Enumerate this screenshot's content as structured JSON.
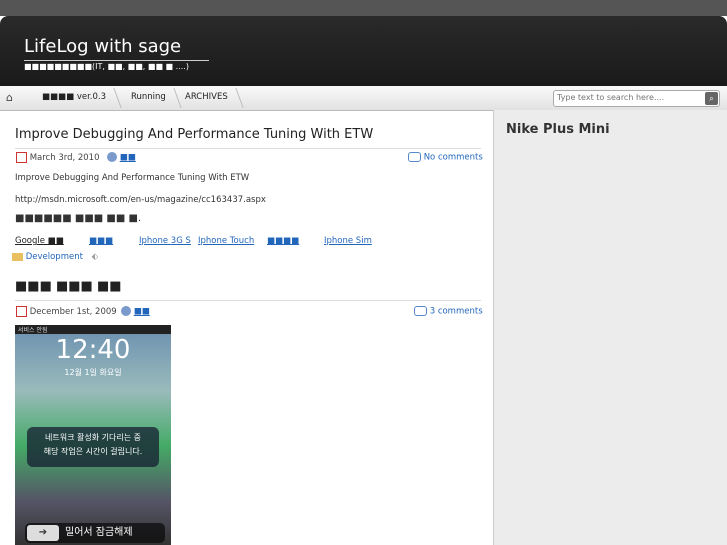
{
  "header": {
    "title": "LifeLog with sage",
    "subtitle": "■■■■■■■■■(IT, ■■, ■■, ■■ ■ ....)"
  },
  "nav": {
    "items": [
      "■■■■ ver.0.3",
      "Running",
      "ARCHIVES"
    ]
  },
  "search": {
    "placeholder": "Type text to search here...."
  },
  "sidebar": {
    "title": "Nike Plus Mini"
  },
  "post1": {
    "title": "Improve Debugging And Performance Tuning With ETW",
    "date": "March 3rd, 2010",
    "author": "■■",
    "comments": "No comments",
    "line1": "Improve Debugging And Performance Tuning With ETW",
    "line2": "http://msdn.microsoft.com/en-us/magazine/cc163437.aspx",
    "line3": "■■■■■■ ■■■ ■■ ■.",
    "tags": [
      "Google ■■",
      "■■■",
      "Iphone 3G S",
      "Iphone Touch",
      "■■■■",
      "Iphone Sim"
    ],
    "category": "Development"
  },
  "post2": {
    "title": "■■■ ■■■ ■■",
    "date": "December 1st, 2009",
    "author": "■■",
    "comments": "3 comments",
    "photo": {
      "carrier": "서비스 안됨",
      "time": "12:40",
      "date": "12월 1일 화요일",
      "msg1": "네트워크 활성화 기다리는 중",
      "msg2": "해당 작업은 시간이 걸립니다.",
      "slide": "밀어서 잠금해제"
    }
  }
}
